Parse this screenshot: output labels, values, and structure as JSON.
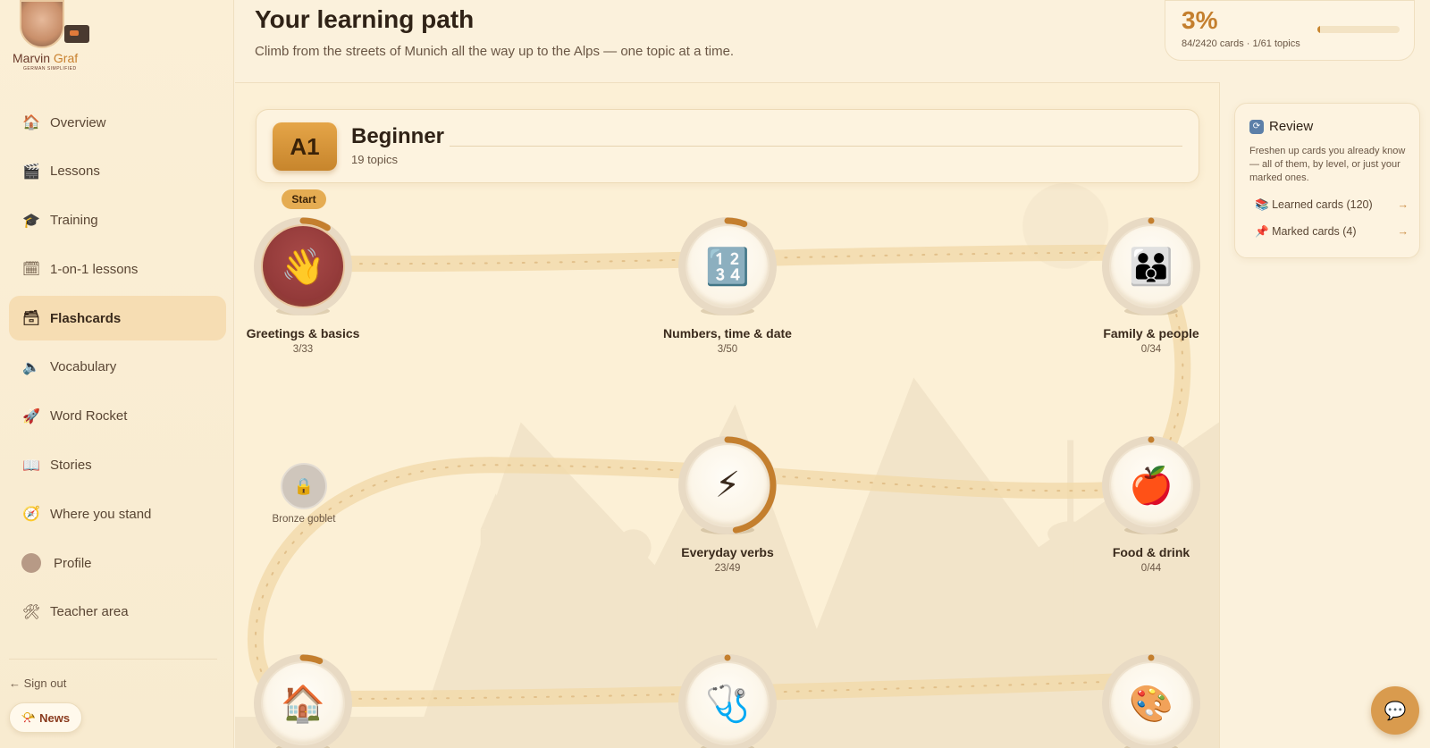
{
  "brand": {
    "name_main": "Marvin ",
    "name_accent": "Graf",
    "tagline": "GERMAN SIMPLIFIED"
  },
  "sidebar": {
    "items": [
      {
        "label": "Overview",
        "icon": "house-icon",
        "glyph": "🏠"
      },
      {
        "label": "Lessons",
        "icon": "clapper-icon",
        "glyph": "🎬"
      },
      {
        "label": "Training",
        "icon": "graduation-cap-icon",
        "glyph": "🎓"
      },
      {
        "label": "1-on-1 lessons",
        "icon": "calendar-icon",
        "glyph": "🗓"
      },
      {
        "label": "Flashcards",
        "icon": "card-box-icon",
        "glyph": "🗃"
      },
      {
        "label": "Vocabulary",
        "icon": "speaker-icon",
        "glyph": "🔈"
      },
      {
        "label": "Word Rocket",
        "icon": "rocket-icon",
        "glyph": "🚀"
      },
      {
        "label": "Stories",
        "icon": "book-icon",
        "glyph": "📖"
      },
      {
        "label": "Where you stand",
        "icon": "compass-icon",
        "glyph": "🧭"
      },
      {
        "label": "Profile",
        "icon": "avatar-icon",
        "glyph": ""
      },
      {
        "label": "Teacher area",
        "icon": "tools-icon",
        "glyph": "🛠"
      }
    ],
    "active_index": 4,
    "sign_out": "← Sign out",
    "news": "News",
    "news_glyph": "📯"
  },
  "header": {
    "title": "Your learning path",
    "subtitle": "Climb from the streets of Munich all the way up to the Alps — one topic at a time."
  },
  "progress": {
    "percent_label": "3%",
    "stats": "84/2420 cards · 1/61 topics",
    "fraction": 0.035
  },
  "level": {
    "badge": "A1",
    "name": "Beginner",
    "topics": "19 topics"
  },
  "start_label": "Start",
  "topics": [
    {
      "name": "Greetings & basics",
      "count": "3/33",
      "glyph": "👋",
      "icon": "waving-hand-icon",
      "progress": 0.09,
      "current": true
    },
    {
      "name": "Numbers, time & date",
      "count": "3/50",
      "glyph": "🔢",
      "icon": "numbers-icon",
      "progress": 0.06,
      "current": false
    },
    {
      "name": "Family & people",
      "count": "0/34",
      "glyph": "👪",
      "icon": "family-icon",
      "progress": 0,
      "current": false
    },
    {
      "name": "Everyday verbs",
      "count": "23/49",
      "glyph": "⚡",
      "icon": "lightning-icon",
      "progress": 0.47,
      "current": false
    },
    {
      "name": "Food & drink",
      "count": "0/44",
      "glyph": "🍎",
      "icon": "apple-icon",
      "progress": 0,
      "current": false
    },
    {
      "name": "",
      "count": "",
      "glyph": "🏠",
      "icon": "house-icon",
      "progress": 0.06,
      "current": false
    },
    {
      "name": "",
      "count": "",
      "glyph": "🩺",
      "icon": "stethoscope-icon",
      "progress": 0,
      "current": false
    },
    {
      "name": "",
      "count": "",
      "glyph": "🎨",
      "icon": "palette-icon",
      "progress": 0,
      "current": false
    }
  ],
  "reward": {
    "label": "Bronze goblet",
    "icon": "lock-icon",
    "glyph": "🔒"
  },
  "review": {
    "title": "Review",
    "description": "Freshen up cards you already know — all of them, by level, or just your marked ones.",
    "links": [
      {
        "label": "Learned cards (120)",
        "glyph": "📚",
        "icon": "books-icon",
        "arrow": "→"
      },
      {
        "label": "Marked cards (4)",
        "glyph": "📌",
        "icon": "pin-icon",
        "arrow": "→"
      }
    ]
  },
  "chat": {
    "icon": "chat-bubble-icon",
    "glyph": "💬"
  },
  "colors": {
    "accent": "#c88630",
    "ring": "#c47f2e",
    "background": "#fbf1dc",
    "active_nav": "#f6ddb3"
  }
}
